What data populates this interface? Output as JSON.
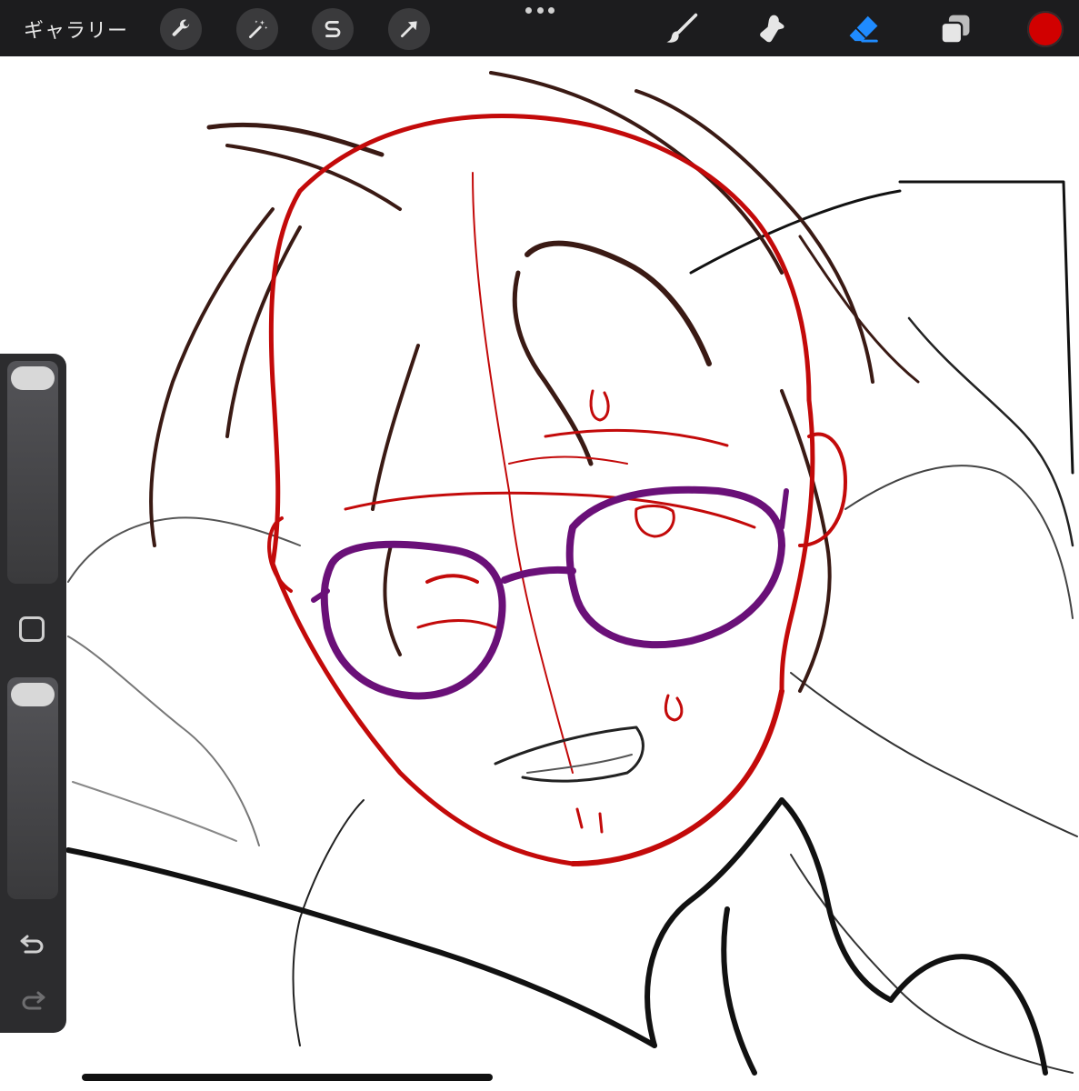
{
  "topbar": {
    "gallery_label": "ギャラリー",
    "left_buttons": [
      "wrench-icon",
      "magic-wand-icon",
      "selection-s-icon",
      "transform-arrow-icon"
    ],
    "more_icon": "ellipsis-icon",
    "tools": [
      "brush-icon",
      "smudge-icon",
      "eraser-icon",
      "layers-icon"
    ],
    "active_tool": "eraser-icon",
    "current_color": "#d10000"
  },
  "sidebar": {
    "brush_size_level": 0.0,
    "opacity_level": 0.0,
    "modify_icon": "square-modify-icon",
    "undo_icon": "undo-icon",
    "redo_icon": "redo-icon"
  },
  "canvas": {
    "background": "#ffffff",
    "stroke_colors": [
      "#3a1a14",
      "#c30a0a",
      "#6a1078",
      "#111111"
    ]
  }
}
